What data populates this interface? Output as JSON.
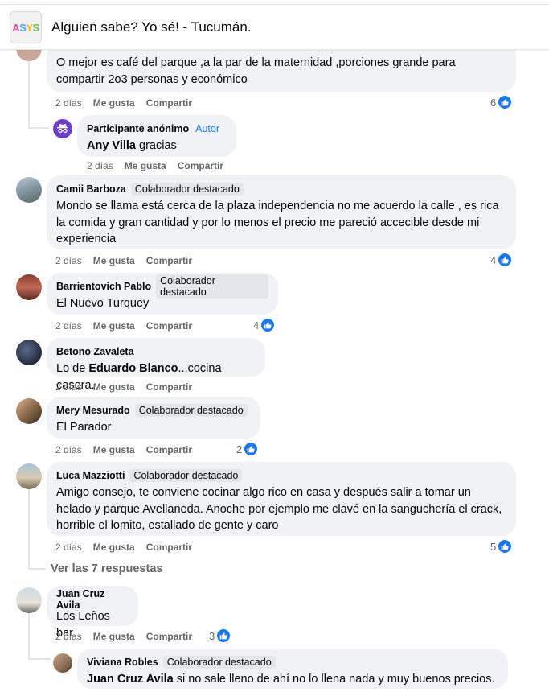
{
  "header": {
    "logo_text": "ASYS",
    "title": "Alguien sabe? Yo sé! - Tucumán."
  },
  "comments": [
    {
      "author": "",
      "badge": "",
      "text": "O mejor es café del parque ,a la par de la maternidad ,porciones grande para compartir 2o3 personas y económico",
      "time": "2 días",
      "like_label": "Me gusta",
      "share_label": "Compartir",
      "reaction_count": "6"
    },
    {
      "author": "Participante anónimo",
      "badge": "Autor",
      "mention": "Any Villa",
      "text": " gracias",
      "time": "2 días",
      "like_label": "Me gusta",
      "share_label": "Compartir",
      "reaction_count": ""
    },
    {
      "author": "Camii Barboza",
      "badge": "Colaborador destacado",
      "text": "Mondo se llama está cerca de la plaza independencia no me acuerdo la calle , es rica la comida y gran cantidad y por lo menos el precio me pareció accecible desde mi experiencia",
      "time": "2 días",
      "like_label": "Me gusta",
      "share_label": "Compartir",
      "reaction_count": "4"
    },
    {
      "author": "Barrientovich Pablo",
      "badge": "Colaborador destacado",
      "text": "El Nuevo Turquey",
      "time": "2 días",
      "like_label": "Me gusta",
      "share_label": "Compartir",
      "reaction_count": "4"
    },
    {
      "author": "Betono Zavaleta",
      "badge": "",
      "prefix": "Lo de ",
      "mention": "Eduardo Blanco",
      "text": "...cocina casera.",
      "time": "2 días",
      "like_label": "Me gusta",
      "share_label": "Compartir",
      "reaction_count": ""
    },
    {
      "author": "Mery Mesurado",
      "badge": "Colaborador destacado",
      "text": "El Parador",
      "time": "2 días",
      "like_label": "Me gusta",
      "share_label": "Compartir",
      "reaction_count": "2"
    },
    {
      "author": "Luca Mazziotti",
      "badge": "Colaborador destacado",
      "text": "Amigo consejo, te conviene cocinar algo rico en casa y después salir a tomar un helado y parque Avellaneda. Anoche por ejemplo me clavé en la sanguchería el crack, horrible el lomito, estallado de gente y caro",
      "time": "2 días",
      "like_label": "Me gusta",
      "share_label": "Compartir",
      "reaction_count": "5",
      "replies_label": "Ver las 7 respuestas"
    },
    {
      "author": "Juan Cruz Avila",
      "badge": "",
      "text": "Los Leños bar",
      "time": "2 días",
      "like_label": "Me gusta",
      "share_label": "Compartir",
      "reaction_count": "3"
    },
    {
      "author": "Viviana Robles",
      "badge": "Colaborador destacado",
      "mention": "Juan Cruz Avila",
      "text": " si no sale lleno de ahí no lo llena nada y muy buenos precios.",
      "time": "",
      "like_label": "",
      "share_label": "",
      "reaction_count": ""
    }
  ],
  "colors": {
    "accent": "#1877f2",
    "bubble": "#f0f2f5",
    "muted": "#65676b"
  }
}
